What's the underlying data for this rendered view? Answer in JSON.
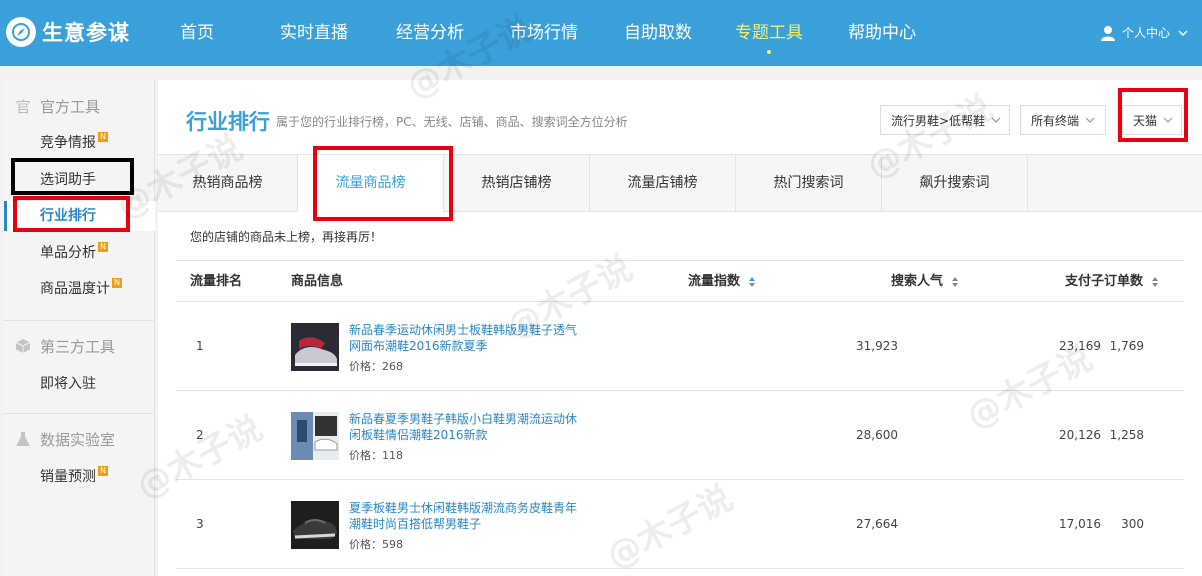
{
  "header": {
    "logo_text": "生意参谋",
    "nav": [
      {
        "label": "首页"
      },
      {
        "label": "实时直播"
      },
      {
        "label": "经营分析"
      },
      {
        "label": "市场行情"
      },
      {
        "label": "自助取数"
      },
      {
        "label": "专题工具",
        "active": true
      },
      {
        "label": "帮助中心"
      }
    ],
    "user_label": "个人中心",
    "accent_color": "#3aa0d9"
  },
  "sidebar": {
    "sections": [
      {
        "title": "官方工具",
        "icon": "official-icon",
        "items": [
          {
            "label": "竞争情报",
            "badge": "N"
          },
          {
            "label": "选词助手"
          },
          {
            "label": "行业排行",
            "active": true
          },
          {
            "label": "单品分析",
            "badge": "N"
          },
          {
            "label": "商品温度计",
            "badge": "N"
          }
        ]
      },
      {
        "title": "第三方工具",
        "icon": "cube-icon",
        "items": [
          {
            "label": "即将入驻"
          }
        ]
      },
      {
        "title": "数据实验室",
        "icon": "flask-icon",
        "items": [
          {
            "label": "销量预测",
            "badge": "N"
          }
        ]
      }
    ]
  },
  "main": {
    "title": "行业排行",
    "subtitle": "属于您的行业排行榜，PC、无线、店铺、商品、搜索词全方位分析",
    "filters": {
      "category": "流行男鞋>低帮鞋",
      "channel": "所有终端",
      "platform": "天猫"
    },
    "tabs": [
      {
        "label": "热销商品榜"
      },
      {
        "label": "流量商品榜",
        "active": true
      },
      {
        "label": "热销店铺榜"
      },
      {
        "label": "流量店铺榜"
      },
      {
        "label": "热门搜索词"
      },
      {
        "label": "飙升搜索词"
      }
    ],
    "notice": "您的店铺的商品未上榜，再接再厉！",
    "table": {
      "headers": {
        "rank": "流量排名",
        "product": "商品信息",
        "traffic": "流量指数",
        "search": "搜索人气",
        "orders": "支付子订单数"
      },
      "rows": [
        {
          "rank": "1",
          "name": "新品春季运动休闲男士板鞋韩版男鞋子透气网面布潮鞋2016新款夏季",
          "price": "价格：268",
          "traffic": "31,923",
          "search": "23,169",
          "orders": "1,769"
        },
        {
          "rank": "2",
          "name": "新品春夏季男鞋子韩版小白鞋男潮流运动休闲板鞋情侣潮鞋2016新款",
          "price": "价格：118",
          "traffic": "28,600",
          "search": "20,126",
          "orders": "1,258"
        },
        {
          "rank": "3",
          "name": "夏季板鞋男士休闲鞋韩版潮流商务皮鞋青年潮鞋时尚百搭低帮男鞋子",
          "price": "价格：598",
          "traffic": "27,664",
          "search": "17,016",
          "orders": "300"
        }
      ]
    }
  },
  "watermark_text": "@木子说"
}
